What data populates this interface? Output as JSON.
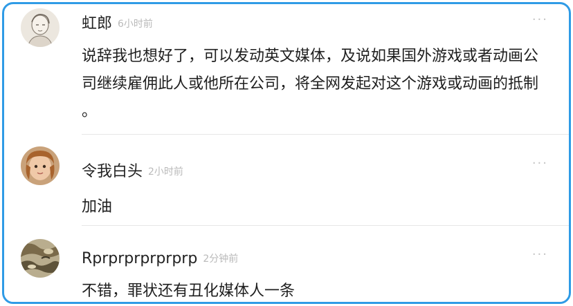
{
  "comments": [
    {
      "username": "虹郎",
      "time": "6小时前",
      "more_label": "···",
      "text": "说辞我也想好了，可以发动英文媒体，及说如果国外游戏或者动画公司继续雇佣此人或他所在公司，将全网发起对这个游戏或动画的抵制 。",
      "avatar_icon": "sketch-portrait-avatar"
    },
    {
      "username": "令我白头",
      "time": "2小时前",
      "more_label": "···",
      "text": "加油",
      "avatar_icon": "child-photo-avatar"
    },
    {
      "username": "Rprprprprprprp",
      "time": "2分钟前",
      "more_label": "···",
      "text": "不错，罪状还有丑化媒体人一条",
      "avatar_icon": "camouflage-avatar"
    }
  ],
  "colors": {
    "border": "#2f9be6",
    "username": "#222222",
    "timestamp": "#b9b9b9",
    "divider": "#e6e6e6"
  }
}
